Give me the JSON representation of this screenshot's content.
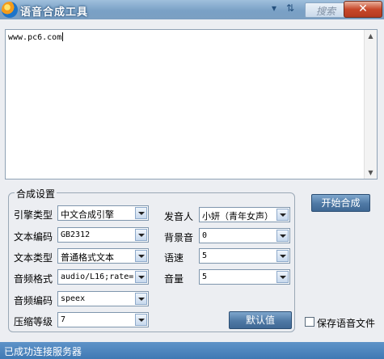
{
  "window": {
    "title": "语音合成工具"
  },
  "titlebar": {
    "dropdown_glyph": "▾",
    "refresh_glyph": "⇅",
    "search_placeholder": "搜索",
    "close_glyph": "✕"
  },
  "editor": {
    "text": "www.pc6.com"
  },
  "settings": {
    "group_label": "合成设置",
    "engine_type": {
      "label": "引擎类型",
      "value": "中文合成引擎"
    },
    "text_encoding": {
      "label": "文本编码",
      "value": "GB2312"
    },
    "text_type": {
      "label": "文本类型",
      "value": "普通格式文本"
    },
    "audio_format": {
      "label": "音频格式",
      "value": "audio/L16;rate="
    },
    "audio_codec": {
      "label": "音频编码",
      "value": "speex"
    },
    "compression_level": {
      "label": "压缩等级",
      "value": "7"
    },
    "speaker": {
      "label": "发音人",
      "value": "小妍（青年女声）"
    },
    "background_sound": {
      "label": "背景音",
      "value": "0"
    },
    "speed": {
      "label": "语速",
      "value": "5"
    },
    "volume": {
      "label": "音量",
      "value": "5"
    },
    "default_button": "默认值"
  },
  "start_button": "开始合成",
  "save_checkbox_label": "保存语音文件",
  "status": {
    "text": "已成功连接服务器"
  }
}
